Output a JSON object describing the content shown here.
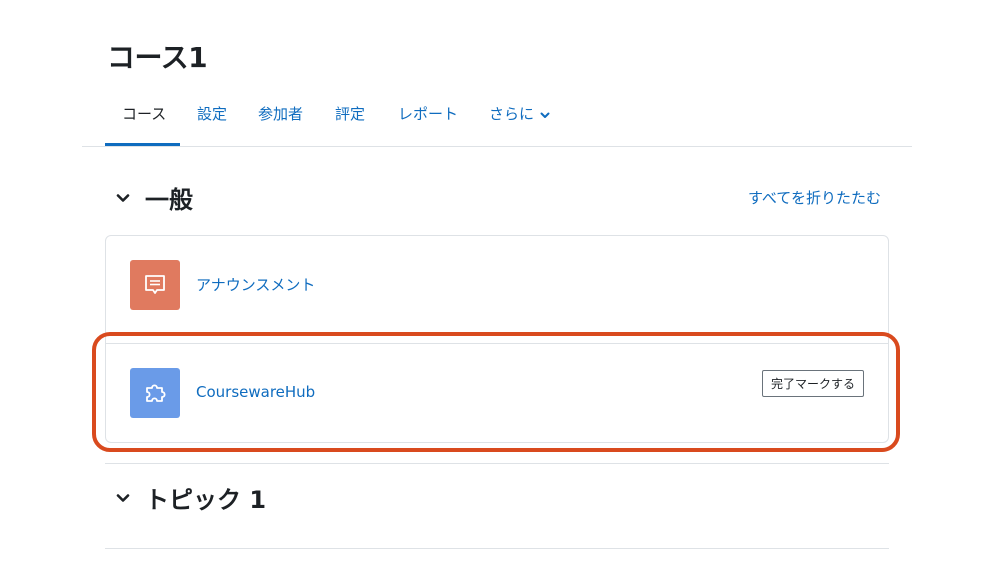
{
  "course": {
    "title": "コース1"
  },
  "nav": {
    "items": [
      {
        "label": "コース"
      },
      {
        "label": "設定"
      },
      {
        "label": "参加者"
      },
      {
        "label": "評定"
      },
      {
        "label": "レポート"
      },
      {
        "label": "さらに"
      }
    ],
    "active_index": 0
  },
  "sections": [
    {
      "title": "一般",
      "collapse_all_label": "すべてを折りたたむ",
      "activities": [
        {
          "name": "アナウンスメント",
          "icon": "forum-icon",
          "icon_color": "#e07a5f"
        },
        {
          "name": "CoursewareHub",
          "icon": "puzzle-icon",
          "icon_color": "#6a9be8",
          "completion_button": "完了マークする"
        }
      ]
    },
    {
      "title": "トピック 1"
    }
  ],
  "colors": {
    "link": "#0f6cbf",
    "highlight_annotation": "#d94a1e"
  }
}
